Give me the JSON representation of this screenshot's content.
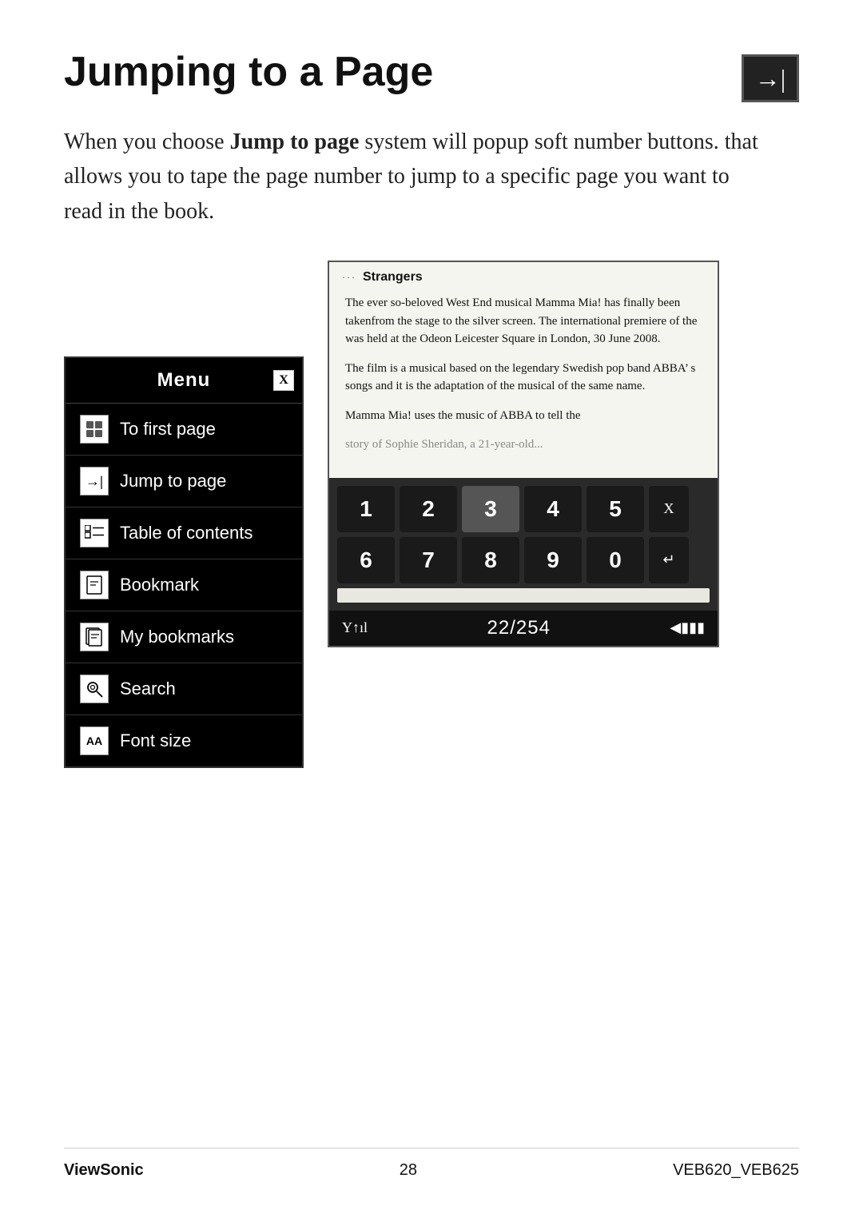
{
  "header": {
    "title": "Jumping to a Page",
    "icon_symbol": "→|"
  },
  "body_text": {
    "part1": "When you choose ",
    "bold": "Jump to page",
    "part2": " system will popup soft number buttons. that allows you to tape the page number to jump to a specific page you want to read in the book."
  },
  "menu": {
    "title": "Menu",
    "close_label": "X",
    "items": [
      {
        "label": "To first page",
        "icon": "⊞"
      },
      {
        "label": "Jump to page",
        "icon": "→|"
      },
      {
        "label": "Table of contents",
        "icon": "☰"
      },
      {
        "label": "Bookmark",
        "icon": "✎"
      },
      {
        "label": "My bookmarks",
        "icon": "📋"
      },
      {
        "label": "Search",
        "icon": "🔍"
      },
      {
        "label": "Font size",
        "icon": "AA"
      }
    ]
  },
  "ebook": {
    "book_title": "Strangers",
    "paragraphs": [
      "The ever so-beloved West End musical Mamma Mia! has finally been takenfrom the stage to the silver screen. The international premiere of the was held at the Odeon Leicester Square in London, 30 June 2008.",
      "The film is a musical based on the legendary Swedish pop band ABBA’ s songs and it is the adaptation of the musical of the same name.",
      "Mamma Mia! uses the music of ABBA to tell the",
      "story of Sophie Sheridan, a 21-year-old..."
    ]
  },
  "numpad": {
    "rows": [
      [
        "1",
        "2",
        "3",
        "4",
        "5"
      ],
      [
        "6",
        "7",
        "8",
        "9",
        "0"
      ]
    ],
    "close_key": "X",
    "backspace_key": "←",
    "enter_key": "↵"
  },
  "status_bar": {
    "signal": "Y↑ıl",
    "page_display": "22/254",
    "battery": "◀▮▮▮"
  },
  "footer": {
    "brand": "ViewSonic",
    "page_number": "28",
    "model": "VEB620_VEB625"
  }
}
